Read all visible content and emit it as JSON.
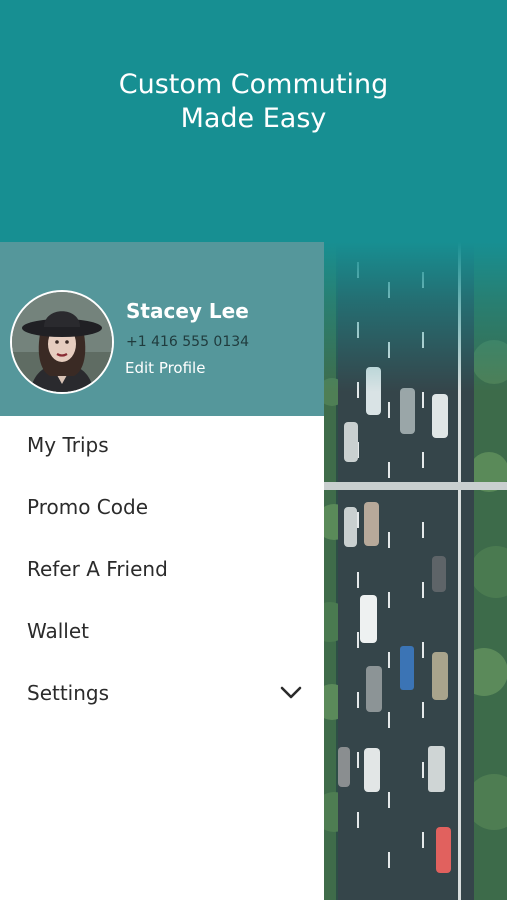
{
  "banner": {
    "title_line1": "Custom Commuting",
    "title_line2": "Made Easy"
  },
  "profile": {
    "name": "Stacey Lee",
    "phone": "+1 416 555 0134",
    "edit_label": "Edit Profile"
  },
  "menu": [
    {
      "label": "My Trips"
    },
    {
      "label": "Promo Code"
    },
    {
      "label": "Refer A Friend"
    },
    {
      "label": "Wallet"
    },
    {
      "label": "Settings"
    }
  ],
  "colors": {
    "brand_teal": "#178f92",
    "drawer_header": "#55979b",
    "menu_text": "#2b2b2b"
  }
}
